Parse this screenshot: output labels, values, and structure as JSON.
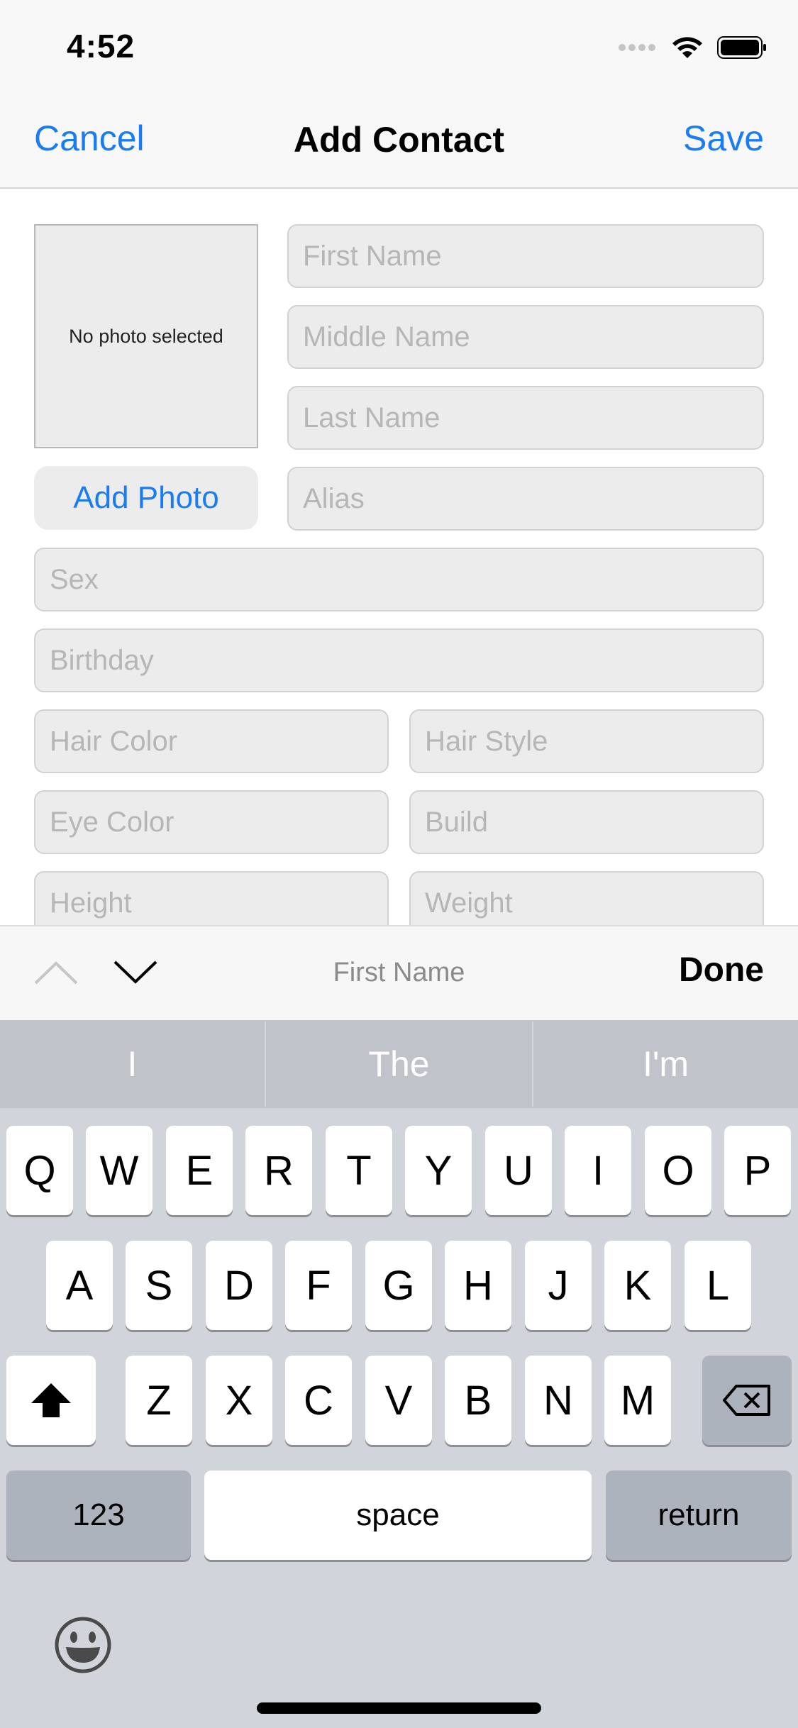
{
  "status": {
    "time": "4:52"
  },
  "nav": {
    "cancel": "Cancel",
    "title": "Add Contact",
    "save": "Save"
  },
  "photo": {
    "placeholder_text": "No photo selected",
    "add_button": "Add Photo"
  },
  "fields": {
    "first_name": "First Name",
    "middle_name": "Middle Name",
    "last_name": "Last Name",
    "alias": "Alias",
    "sex": "Sex",
    "birthday": "Birthday",
    "hair_color": "Hair Color",
    "hair_style": "Hair Style",
    "eye_color": "Eye Color",
    "build": "Build",
    "height": "Height",
    "weight": "Weight"
  },
  "accessory": {
    "current_field": "First Name",
    "done": "Done"
  },
  "keyboard": {
    "suggestions": [
      "I",
      "The",
      "I'm"
    ],
    "row1": [
      "Q",
      "W",
      "E",
      "R",
      "T",
      "Y",
      "U",
      "I",
      "O",
      "P"
    ],
    "row2": [
      "A",
      "S",
      "D",
      "F",
      "G",
      "H",
      "J",
      "K",
      "L"
    ],
    "row3": [
      "Z",
      "X",
      "C",
      "V",
      "B",
      "N",
      "M"
    ],
    "numbers_key": "123",
    "space_key": "space",
    "return_key": "return"
  },
  "colors": {
    "accent": "#1a7cf2",
    "field_bg": "#ececec",
    "keyboard_bg": "#d1d4da"
  }
}
